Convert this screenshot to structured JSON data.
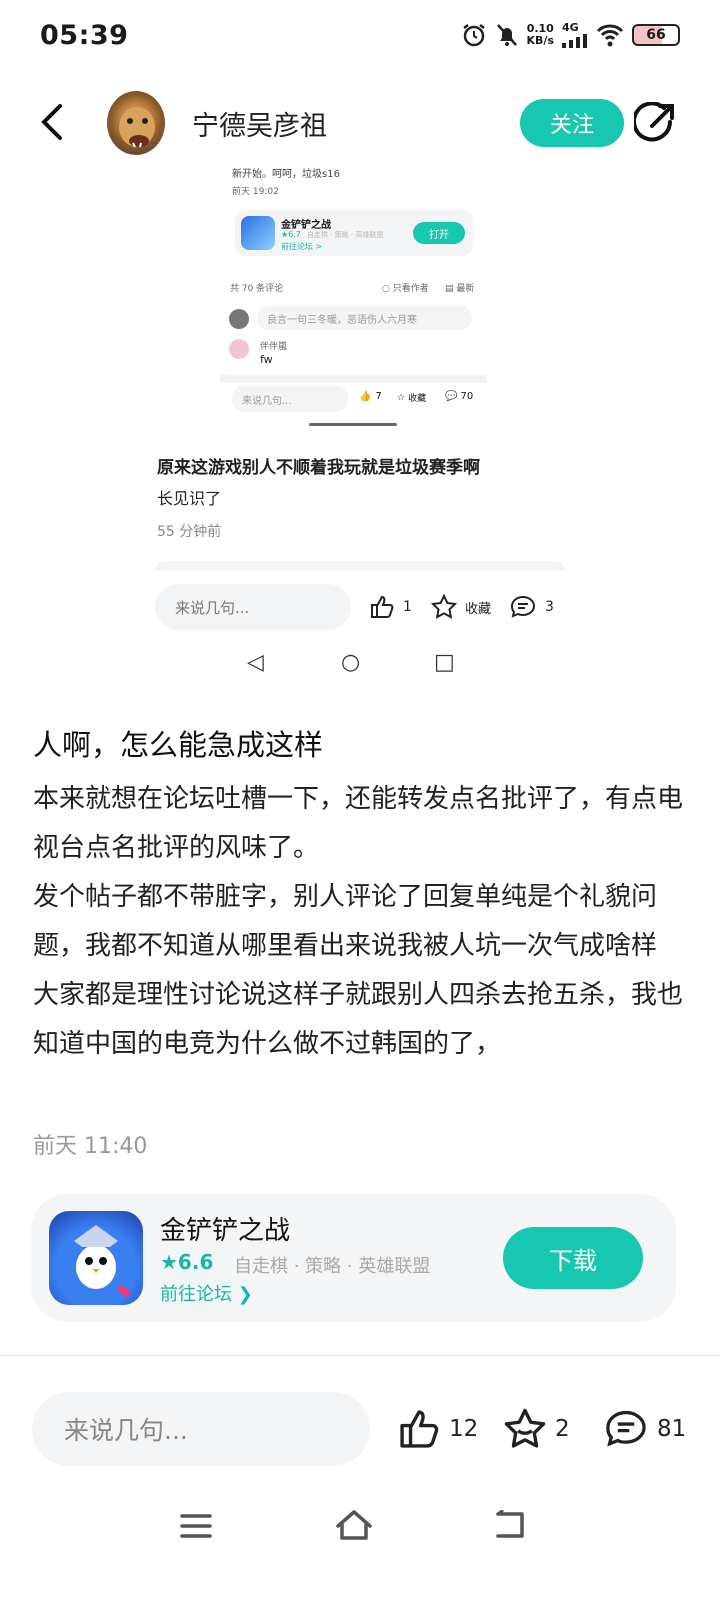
{
  "status_bar": {
    "time": "05:39",
    "net_speed_value": "0.10",
    "net_speed_unit": "KB/s",
    "network": "4G",
    "battery": "66"
  },
  "header": {
    "username": "宁德吴彦祖",
    "follow_label": "关注"
  },
  "embedded": {
    "top_fragment": "新开始。呵呵，垃圾s16",
    "top_time": "前天 19:02",
    "mini_card": {
      "app_name": "金铲铲之战",
      "rating": "★6.7",
      "tags": "自走棋 · 策略 · 英雄联盟",
      "forum": "前往论坛 >",
      "open_label": "打开"
    },
    "comments_count": "共 70 条评论",
    "only_author": "○ 只看作者",
    "sort_latest": "最新",
    "comment_placeholder": "良言一句三冬暖，恶语伤人六月寒",
    "commenter": "伴伴嵐",
    "comment_text": "fw",
    "mini_bottom": {
      "placeholder": "来说几句...",
      "likes": "7",
      "collect": "收藏",
      "comments": "70"
    },
    "post": {
      "title": "原来这游戏别人不顺着我玩就是垃圾赛季啊",
      "body": "长见识了",
      "time": "55 分钟前"
    },
    "bottom": {
      "placeholder": "来说几句...",
      "likes": "1",
      "collect": "收藏",
      "comments": "3"
    }
  },
  "post": {
    "title": "人啊，怎么能急成这样",
    "paragraphs": [
      "本来就想在论坛吐槽一下，还能转发点名批评了，有点电视台点名批评的风味了。",
      "发个帖子都不带脏字，别人评论了回复单纯是个礼貌问题，我都不知道从哪里看出来说我被人坑一次气成啥样",
      "大家都是理性讨论说这样子就跟别人四杀去抢五杀，我也知道中国的电竞为什么做不过韩国的了，"
    ],
    "time": "前天 11:40"
  },
  "app_card": {
    "name": "金铲铲之战",
    "rating": "★6.6",
    "tags": "自走棋 · 策略 · 英雄联盟",
    "forum": "前往论坛 ❯",
    "download_label": "下载"
  },
  "bottom_bar": {
    "placeholder": "来说几句...",
    "likes": "12",
    "favorites": "2",
    "comments": "81"
  },
  "colors": {
    "accent": "#17c7b0",
    "text": "#1a1a1a",
    "muted": "#999999"
  }
}
